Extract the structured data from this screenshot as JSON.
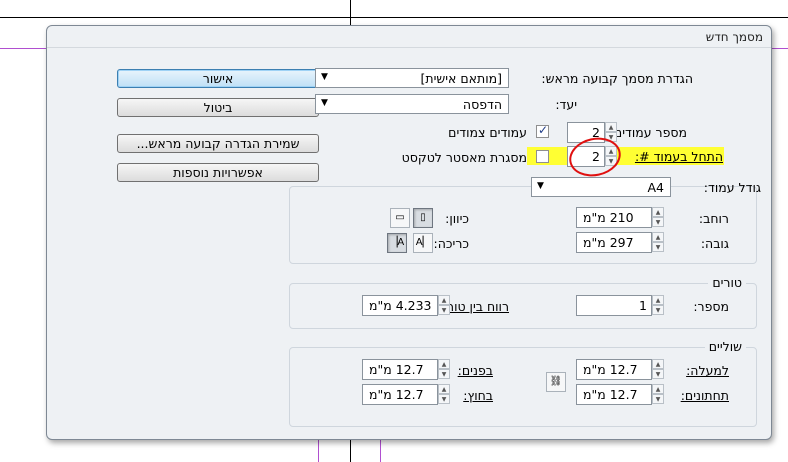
{
  "dialog": {
    "title": "מסמך חדש"
  },
  "preset": {
    "label": "הגדרת מסמך קבועה מראש:",
    "value": "[מותאם אישית]"
  },
  "intent": {
    "label": "יעד:",
    "value": "הדפסה"
  },
  "pages": {
    "count_label": "מספר עמודים:",
    "count_value": "2",
    "facing_label": "עמודים צמודים",
    "facing_checked": true,
    "start_label": "התחל בעמוד #:",
    "start_value": "2",
    "master_label": "מסגרת מאסטר לטקסט",
    "master_checked": false
  },
  "page_size": {
    "label": "גודל עמוד:",
    "value": "A4",
    "width_label": "רוחב:",
    "width_value": "210 מ\"מ",
    "height_label": "גובה:",
    "height_value": "297 מ\"מ",
    "orientation_label": "כיוון:",
    "binding_label": "כריכה:"
  },
  "columns": {
    "legend": "טורים",
    "number_label": "מספר:",
    "number_value": "1",
    "gutter_label": "רווח בין טורים:",
    "gutter_value": "4.233 מ\"מ"
  },
  "margins": {
    "legend": "שוליים",
    "top_label": "למעלה:",
    "top_value": "12.7 מ\"מ",
    "bottom_label": "תחתונים:",
    "bottom_value": "12.7 מ\"מ",
    "inside_label": "בפנים:",
    "inside_value": "12.7 מ\"מ",
    "outside_label": "בחוץ:",
    "outside_value": "12.7 מ\"מ"
  },
  "buttons": {
    "ok": "אישור",
    "cancel": "ביטול",
    "save_preset": "שמירת הגדרה קבועה מראש...",
    "more_options": "אפשרויות נוספות"
  },
  "colors": {
    "highlight": "#ffff33",
    "annotation_circle": "#e01010",
    "guide": "#b04fd0"
  }
}
